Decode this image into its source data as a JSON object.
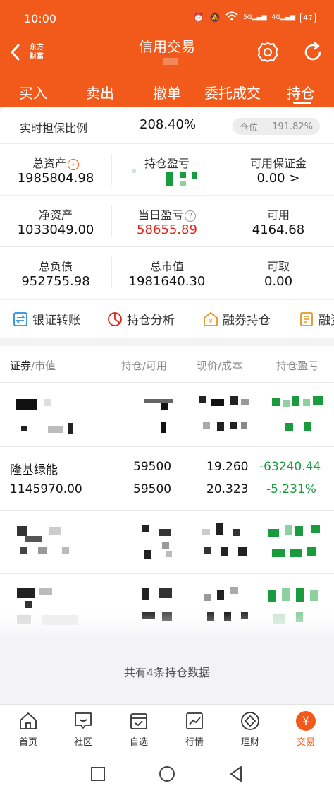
{
  "status_bar": {
    "time": "10:00",
    "signal1": "5G",
    "signal2": "4G",
    "battery": "47"
  },
  "header": {
    "logo_line1": "东方",
    "logo_line2": "财富",
    "title": "信用交易"
  },
  "tabs": [
    {
      "label": "买入"
    },
    {
      "label": "卖出"
    },
    {
      "label": "撤单"
    },
    {
      "label": "委托成交"
    },
    {
      "label": "持仓"
    }
  ],
  "summary": {
    "ratio_label": "实时担保比例",
    "ratio_value": "208.40%",
    "position_label": "仓位",
    "position_value": "191.82%",
    "cells": [
      {
        "label": "总资产",
        "value": "1985804.98"
      },
      {
        "label": "持仓盈亏",
        "value": ""
      },
      {
        "label": "可用保证金",
        "value": "0.00 >"
      },
      {
        "label": "净资产",
        "value": "1033049.00"
      },
      {
        "label": "当日盈亏",
        "value": "58655.89"
      },
      {
        "label": "可用",
        "value": "4164.68"
      },
      {
        "label": "总负债",
        "value": "952755.98"
      },
      {
        "label": "总市值",
        "value": "1981640.30"
      },
      {
        "label": "可取",
        "value": "0.00"
      }
    ]
  },
  "quick_actions": [
    {
      "label": "银证转账",
      "icon": "transfer-icon"
    },
    {
      "label": "持仓分析",
      "icon": "pie-chart-icon"
    },
    {
      "label": "融券持仓",
      "icon": "yen-house-icon"
    },
    {
      "label": "融资",
      "icon": "document-icon"
    }
  ],
  "table": {
    "headers": {
      "col1_main": "证券",
      "col1_sub": "/市值",
      "col2": "持仓/可用",
      "col3": "现价/成本",
      "col4": "持仓盈亏"
    },
    "rows": [
      {
        "name": "",
        "market_value": "",
        "hold": "",
        "available": "",
        "price": "",
        "cost": "",
        "pnl": "",
        "pnl_pct": ""
      },
      {
        "name": "隆基绿能",
        "market_value": "1145970.00",
        "hold": "59500",
        "available": "59500",
        "price": "19.260",
        "cost": "20.323",
        "pnl": "-63240.44",
        "pnl_pct": "-5.231%"
      },
      {
        "name": "",
        "market_value": "",
        "hold": "",
        "available": "",
        "price": "",
        "cost": "",
        "pnl": "",
        "pnl_pct": ""
      },
      {
        "name": "",
        "market_value": "",
        "hold": "",
        "available": "",
        "price": "",
        "cost": "",
        "pnl": "",
        "pnl_pct": ""
      }
    ],
    "footer": "共有4条持仓数据"
  },
  "bottom_nav": [
    {
      "label": "首页",
      "icon": "home-icon"
    },
    {
      "label": "社区",
      "icon": "chat-icon"
    },
    {
      "label": "自选",
      "icon": "checklist-icon"
    },
    {
      "label": "行情",
      "icon": "chart-icon"
    },
    {
      "label": "理财",
      "icon": "diamond-icon"
    },
    {
      "label": "交易",
      "icon": "yen-icon",
      "glyph": "¥"
    }
  ],
  "colors": {
    "brand": "#f25a1c",
    "loss": "#1a9c3e",
    "gain": "#e2231a"
  }
}
